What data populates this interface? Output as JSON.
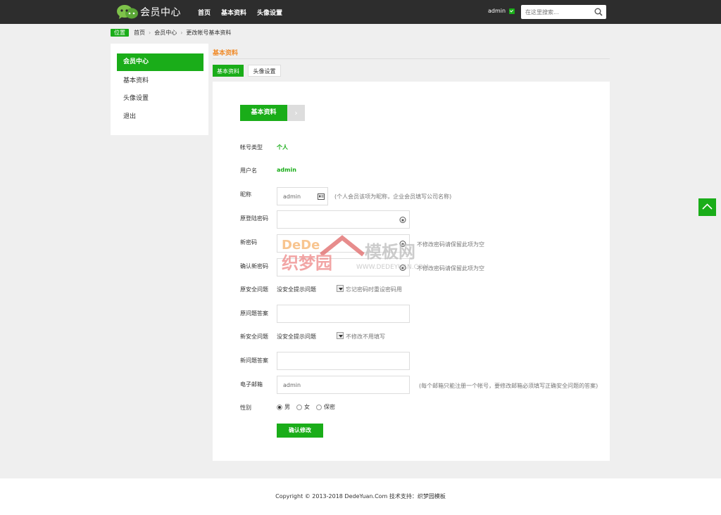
{
  "header": {
    "logo_text": "会员中心",
    "nav": [
      "首页",
      "基本资料",
      "头像设置"
    ],
    "user": "admin",
    "search_placeholder": "在这里搜索..."
  },
  "breadcrumb": {
    "badge": "位置",
    "items": [
      "首页",
      "会员中心",
      "更改帐号基本资料"
    ]
  },
  "sidebar": {
    "items": [
      {
        "label": "会员中心",
        "active": true
      },
      {
        "label": "基本资料",
        "active": false
      },
      {
        "label": "头像设置",
        "active": false
      },
      {
        "label": "退出",
        "active": false
      }
    ]
  },
  "main": {
    "section_title": "基本资料",
    "tabs": [
      {
        "label": "基本资料",
        "active": true
      },
      {
        "label": "头像设置",
        "active": false
      }
    ],
    "step_label": "基本资料",
    "step_arrow": "›",
    "form": {
      "account_type_label": "帐号类型",
      "account_type_value": "个人",
      "username_label": "用户名",
      "username_value": "admin",
      "nickname_label": "昵称",
      "nickname_value": "admin",
      "nickname_hint": "(个人会员该项为昵称，企业会员填写公司名称)",
      "old_password_label": "原登陆密码",
      "new_password_label": "新密码",
      "new_password_hint": "不修改密码请保留此项为空",
      "confirm_password_label": "确认新密码",
      "confirm_password_hint": "不修改密码请保留此项为空",
      "old_question_label": "原安全问题",
      "old_question_value": "没安全提示问题",
      "old_question_hint": "忘记密码时重设密码用",
      "old_answer_label": "原问题答案",
      "new_question_label": "新安全问题",
      "new_question_value": "没安全提示问题",
      "new_question_hint": "不修改不用填写",
      "new_answer_label": "新问题答案",
      "email_label": "电子邮箱",
      "email_value": "admin",
      "email_hint": "(每个邮箱只能注册一个帐号，要修改邮箱必须填写正确安全问题的答案)",
      "gender_label": "性别",
      "gender_options": [
        {
          "label": "男",
          "checked": true
        },
        {
          "label": "女",
          "checked": false
        },
        {
          "label": "保密",
          "checked": false
        }
      ],
      "submit_label": "确认修改"
    }
  },
  "watermark": {
    "brand_en": "DeDe",
    "brand_cn_1": "织梦园",
    "brand_cn_2": "模板网",
    "url": "WWW.DEDEYUAN.COM"
  },
  "footer": {
    "copyright": "Copyright © 2013-2018 DedeYuan.Com 技术支持：织梦园模板"
  },
  "colors": {
    "accent": "#1aad19",
    "header_bg": "#2d2d2d",
    "section_title": "#f08c2b"
  }
}
